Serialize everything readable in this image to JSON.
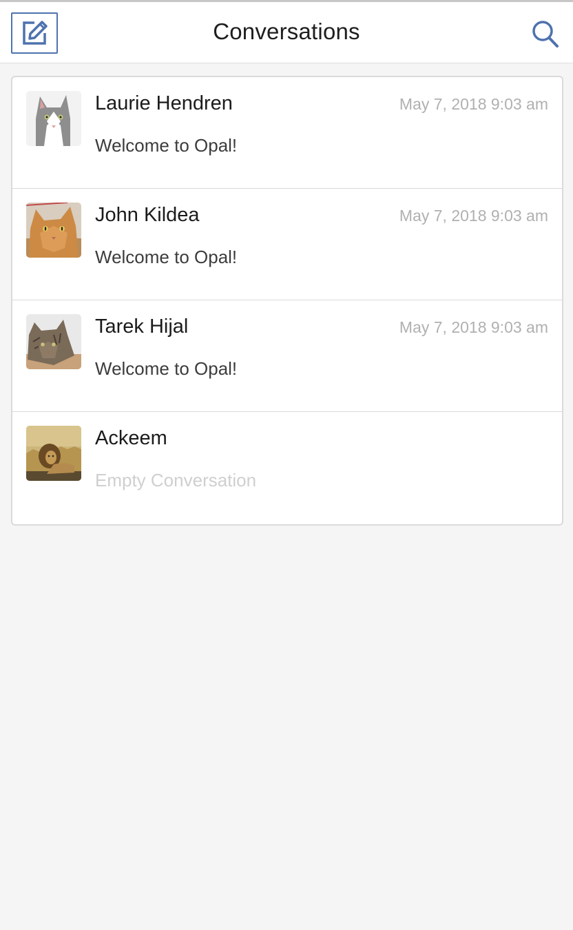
{
  "header": {
    "title": "Conversations",
    "compose_icon": "compose-icon",
    "search_icon": "search-icon"
  },
  "colors": {
    "accent": "#4e72ad",
    "timestamp": "#b0b0b0",
    "empty_text": "#cfcfcf"
  },
  "conversations": [
    {
      "name": "Laurie Hendren",
      "time": "May 7, 2018 9:03 am",
      "preview": "Welcome to Opal!",
      "avatar": "cat-avatar-gray-white"
    },
    {
      "name": "John Kildea",
      "time": "May 7, 2018 9:03 am",
      "preview": "Welcome to Opal!",
      "avatar": "cat-avatar-orange"
    },
    {
      "name": "Tarek Hijal",
      "time": "May 7, 2018 9:03 am",
      "preview": "Welcome to Opal!",
      "avatar": "cat-avatar-tabby"
    },
    {
      "name": "Ackeem",
      "time": "",
      "preview": "Empty Conversation",
      "avatar": "lion-avatar"
    }
  ]
}
